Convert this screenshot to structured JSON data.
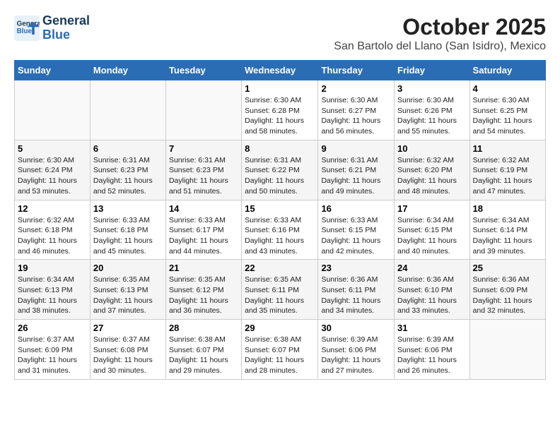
{
  "header": {
    "logo_line1": "General",
    "logo_line2": "Blue",
    "title": "October 2025",
    "subtitle": "San Bartolo del Llano (San Isidro), Mexico"
  },
  "days_of_week": [
    "Sunday",
    "Monday",
    "Tuesday",
    "Wednesday",
    "Thursday",
    "Friday",
    "Saturday"
  ],
  "weeks": [
    [
      {
        "day": "",
        "info": ""
      },
      {
        "day": "",
        "info": ""
      },
      {
        "day": "",
        "info": ""
      },
      {
        "day": "1",
        "sunrise": "6:30 AM",
        "sunset": "6:28 PM",
        "daylight": "11 hours and 58 minutes."
      },
      {
        "day": "2",
        "sunrise": "6:30 AM",
        "sunset": "6:27 PM",
        "daylight": "11 hours and 56 minutes."
      },
      {
        "day": "3",
        "sunrise": "6:30 AM",
        "sunset": "6:26 PM",
        "daylight": "11 hours and 55 minutes."
      },
      {
        "day": "4",
        "sunrise": "6:30 AM",
        "sunset": "6:25 PM",
        "daylight": "11 hours and 54 minutes."
      }
    ],
    [
      {
        "day": "5",
        "sunrise": "6:30 AM",
        "sunset": "6:24 PM",
        "daylight": "11 hours and 53 minutes."
      },
      {
        "day": "6",
        "sunrise": "6:31 AM",
        "sunset": "6:23 PM",
        "daylight": "11 hours and 52 minutes."
      },
      {
        "day": "7",
        "sunrise": "6:31 AM",
        "sunset": "6:23 PM",
        "daylight": "11 hours and 51 minutes."
      },
      {
        "day": "8",
        "sunrise": "6:31 AM",
        "sunset": "6:22 PM",
        "daylight": "11 hours and 50 minutes."
      },
      {
        "day": "9",
        "sunrise": "6:31 AM",
        "sunset": "6:21 PM",
        "daylight": "11 hours and 49 minutes."
      },
      {
        "day": "10",
        "sunrise": "6:32 AM",
        "sunset": "6:20 PM",
        "daylight": "11 hours and 48 minutes."
      },
      {
        "day": "11",
        "sunrise": "6:32 AM",
        "sunset": "6:19 PM",
        "daylight": "11 hours and 47 minutes."
      }
    ],
    [
      {
        "day": "12",
        "sunrise": "6:32 AM",
        "sunset": "6:18 PM",
        "daylight": "11 hours and 46 minutes."
      },
      {
        "day": "13",
        "sunrise": "6:33 AM",
        "sunset": "6:18 PM",
        "daylight": "11 hours and 45 minutes."
      },
      {
        "day": "14",
        "sunrise": "6:33 AM",
        "sunset": "6:17 PM",
        "daylight": "11 hours and 44 minutes."
      },
      {
        "day": "15",
        "sunrise": "6:33 AM",
        "sunset": "6:16 PM",
        "daylight": "11 hours and 43 minutes."
      },
      {
        "day": "16",
        "sunrise": "6:33 AM",
        "sunset": "6:15 PM",
        "daylight": "11 hours and 42 minutes."
      },
      {
        "day": "17",
        "sunrise": "6:34 AM",
        "sunset": "6:15 PM",
        "daylight": "11 hours and 40 minutes."
      },
      {
        "day": "18",
        "sunrise": "6:34 AM",
        "sunset": "6:14 PM",
        "daylight": "11 hours and 39 minutes."
      }
    ],
    [
      {
        "day": "19",
        "sunrise": "6:34 AM",
        "sunset": "6:13 PM",
        "daylight": "11 hours and 38 minutes."
      },
      {
        "day": "20",
        "sunrise": "6:35 AM",
        "sunset": "6:13 PM",
        "daylight": "11 hours and 37 minutes."
      },
      {
        "day": "21",
        "sunrise": "6:35 AM",
        "sunset": "6:12 PM",
        "daylight": "11 hours and 36 minutes."
      },
      {
        "day": "22",
        "sunrise": "6:35 AM",
        "sunset": "6:11 PM",
        "daylight": "11 hours and 35 minutes."
      },
      {
        "day": "23",
        "sunrise": "6:36 AM",
        "sunset": "6:11 PM",
        "daylight": "11 hours and 34 minutes."
      },
      {
        "day": "24",
        "sunrise": "6:36 AM",
        "sunset": "6:10 PM",
        "daylight": "11 hours and 33 minutes."
      },
      {
        "day": "25",
        "sunrise": "6:36 AM",
        "sunset": "6:09 PM",
        "daylight": "11 hours and 32 minutes."
      }
    ],
    [
      {
        "day": "26",
        "sunrise": "6:37 AM",
        "sunset": "6:09 PM",
        "daylight": "11 hours and 31 minutes."
      },
      {
        "day": "27",
        "sunrise": "6:37 AM",
        "sunset": "6:08 PM",
        "daylight": "11 hours and 30 minutes."
      },
      {
        "day": "28",
        "sunrise": "6:38 AM",
        "sunset": "6:07 PM",
        "daylight": "11 hours and 29 minutes."
      },
      {
        "day": "29",
        "sunrise": "6:38 AM",
        "sunset": "6:07 PM",
        "daylight": "11 hours and 28 minutes."
      },
      {
        "day": "30",
        "sunrise": "6:39 AM",
        "sunset": "6:06 PM",
        "daylight": "11 hours and 27 minutes."
      },
      {
        "day": "31",
        "sunrise": "6:39 AM",
        "sunset": "6:06 PM",
        "daylight": "11 hours and 26 minutes."
      },
      {
        "day": "",
        "info": ""
      }
    ]
  ]
}
